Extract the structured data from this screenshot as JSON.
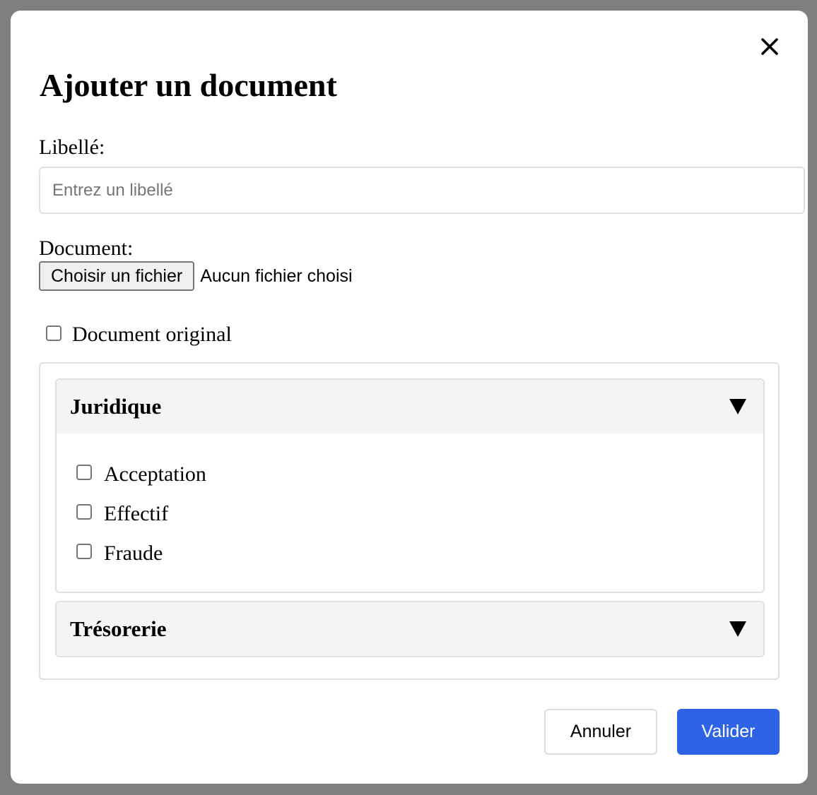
{
  "modal": {
    "title": "Ajouter un document",
    "close_icon": "close-icon"
  },
  "form": {
    "label_field": {
      "label": "Libellé:",
      "value": "",
      "placeholder": "Entrez un libellé"
    },
    "document_field": {
      "label": "Document:",
      "button_label": "Choisir un fichier",
      "status": "Aucun fichier choisi"
    },
    "original_checkbox": {
      "label": "Document original",
      "checked": false
    }
  },
  "categories": [
    {
      "title": "Juridique",
      "expanded": true,
      "caret_icon": "caret-down-icon",
      "items": [
        {
          "label": "Acceptation",
          "checked": false
        },
        {
          "label": "Effectif",
          "checked": false
        },
        {
          "label": "Fraude",
          "checked": false
        }
      ]
    },
    {
      "title": "Trésorerie",
      "expanded": false,
      "caret_icon": "caret-down-icon",
      "items": []
    }
  ],
  "footer": {
    "cancel_label": "Annuler",
    "submit_label": "Valider"
  },
  "colors": {
    "primary": "#2f63e6",
    "overlay": "#7f7f7f",
    "panel_header": "#f4f4f4",
    "border": "#e0e0e0"
  }
}
